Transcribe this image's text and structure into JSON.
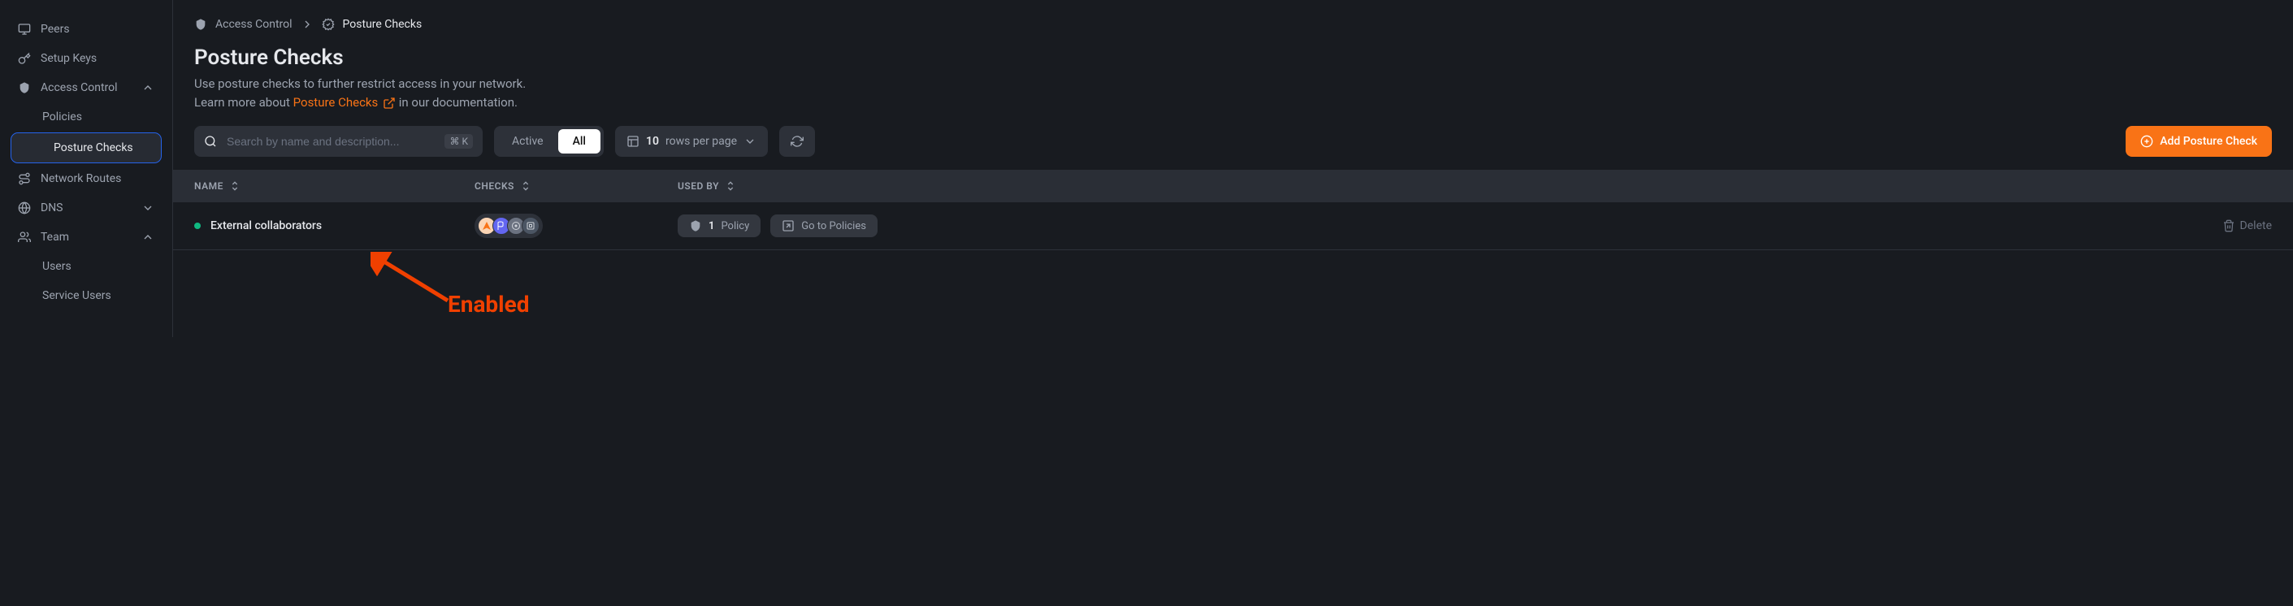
{
  "sidebar": {
    "items": [
      {
        "label": "Peers",
        "icon": "monitor-icon"
      },
      {
        "label": "Setup Keys",
        "icon": "key-icon"
      },
      {
        "label": "Access Control",
        "icon": "shield-icon",
        "expandable": true,
        "expanded": true
      },
      {
        "label": "Policies",
        "sub": true
      },
      {
        "label": "Posture Checks",
        "sub": true,
        "active": true
      },
      {
        "label": "Network Routes",
        "icon": "route-icon"
      },
      {
        "label": "DNS",
        "icon": "globe-icon",
        "expandable": true
      },
      {
        "label": "Team",
        "icon": "users-icon",
        "expandable": true,
        "expanded": true
      },
      {
        "label": "Users",
        "sub": true
      },
      {
        "label": "Service Users",
        "sub": true
      }
    ]
  },
  "breadcrumb": {
    "root": "Access Control",
    "current": "Posture Checks"
  },
  "page": {
    "title": "Posture Checks",
    "subtitle_line1": "Use posture checks to further restrict access in your network.",
    "subtitle_prefix": "Learn more about ",
    "subtitle_link": "Posture Checks",
    "subtitle_suffix": " in our documentation."
  },
  "toolbar": {
    "search_placeholder": "Search by name and description...",
    "search_shortcut": "⌘ K",
    "filter_active": "Active",
    "filter_all": "All",
    "rows_count": "10",
    "rows_label": "rows per page",
    "add_button": "Add Posture Check"
  },
  "table": {
    "columns": {
      "name": "NAME",
      "checks": "CHECKS",
      "usedby": "USED BY"
    },
    "rows": [
      {
        "status": "enabled",
        "name": "External collaborators",
        "check_icons": [
          "location-icon",
          "flag-icon",
          "netbird-icon",
          "os-icon"
        ],
        "policy_count": "1",
        "policy_label": "Policy",
        "goto_label": "Go to Policies",
        "delete_label": "Delete"
      }
    ]
  },
  "annotation": {
    "label": "Enabled"
  },
  "colors": {
    "check_circles": [
      "#fbd5b5",
      "#6366f1",
      "#6b7280",
      "#4b5563"
    ]
  }
}
